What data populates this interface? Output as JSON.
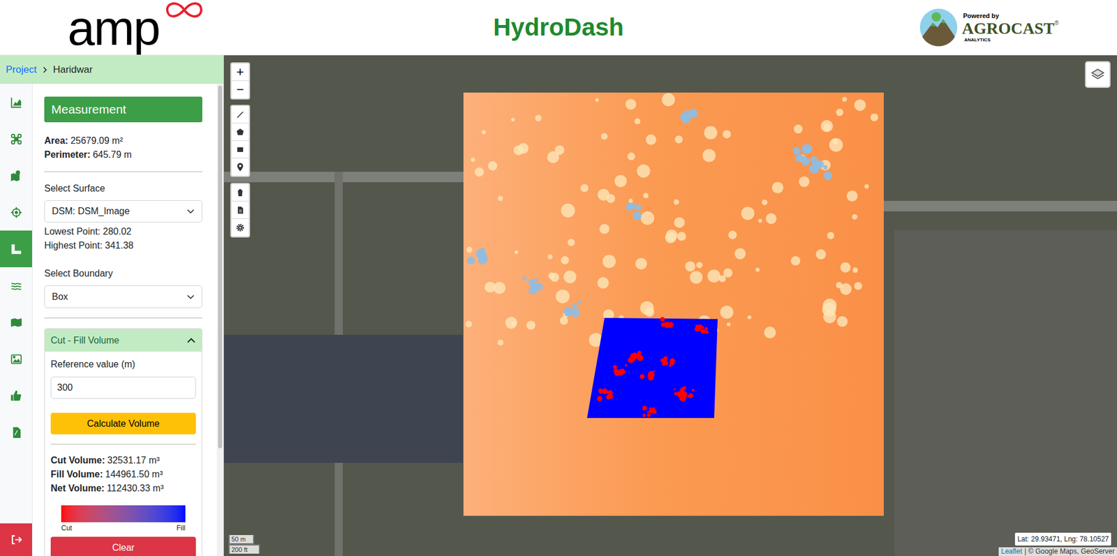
{
  "header": {
    "logo_text": "amp",
    "title": "HydroDash",
    "powered_by": "Powered by",
    "brand": "AGROCAST",
    "brand_mark": "®",
    "brand_sub": "ANALYTICS"
  },
  "breadcrumb": [
    {
      "label": "Project",
      "link": true
    },
    {
      "label": "Haridwar",
      "link": false
    }
  ],
  "rail": {
    "items": [
      {
        "selected": false
      },
      {
        "selected": false
      },
      {
        "selected": false
      },
      {
        "selected": false
      },
      {
        "selected": true
      },
      {
        "selected": false
      },
      {
        "selected": false
      },
      {
        "selected": false
      },
      {
        "selected": false
      },
      {
        "selected": false
      }
    ]
  },
  "measurement": {
    "title": "Measurement",
    "area_label": "Area:",
    "area_value": "25679.09 m²",
    "perimeter_label": "Perimeter:",
    "perimeter_value": "645.79 m"
  },
  "surface": {
    "label": "Select Surface",
    "value": "DSM: DSM_Image",
    "lowest": "Lowest Point: 280.02",
    "highest": "Highest Point: 341.38"
  },
  "boundary": {
    "label": "Select Boundary",
    "value": "Box"
  },
  "cut_fill": {
    "title": "Cut - Fill Volume",
    "expanded": true,
    "reference_label": "Reference value (m)",
    "reference_value": "300",
    "button": "Calculate Volume",
    "results": [
      {
        "label": "Cut Volume:",
        "value": "32531.17 m³"
      },
      {
        "label": "Fill Volume:",
        "value": "144961.50 m³"
      },
      {
        "label": "Net Volume:",
        "value": "112430.33 m³"
      }
    ],
    "legend": {
      "low": "Cut",
      "high": "Fill"
    }
  },
  "clear_button": "Clear",
  "map": {
    "zoom_in": "+",
    "zoom_out": "−",
    "scale": [
      "50 m",
      "200 ft"
    ],
    "coordinates": "Lat: 29.93471, Lng: 78.10527",
    "attribution_link": "Leaflet",
    "attribution_text": "| © Google Maps, GeoServer"
  }
}
